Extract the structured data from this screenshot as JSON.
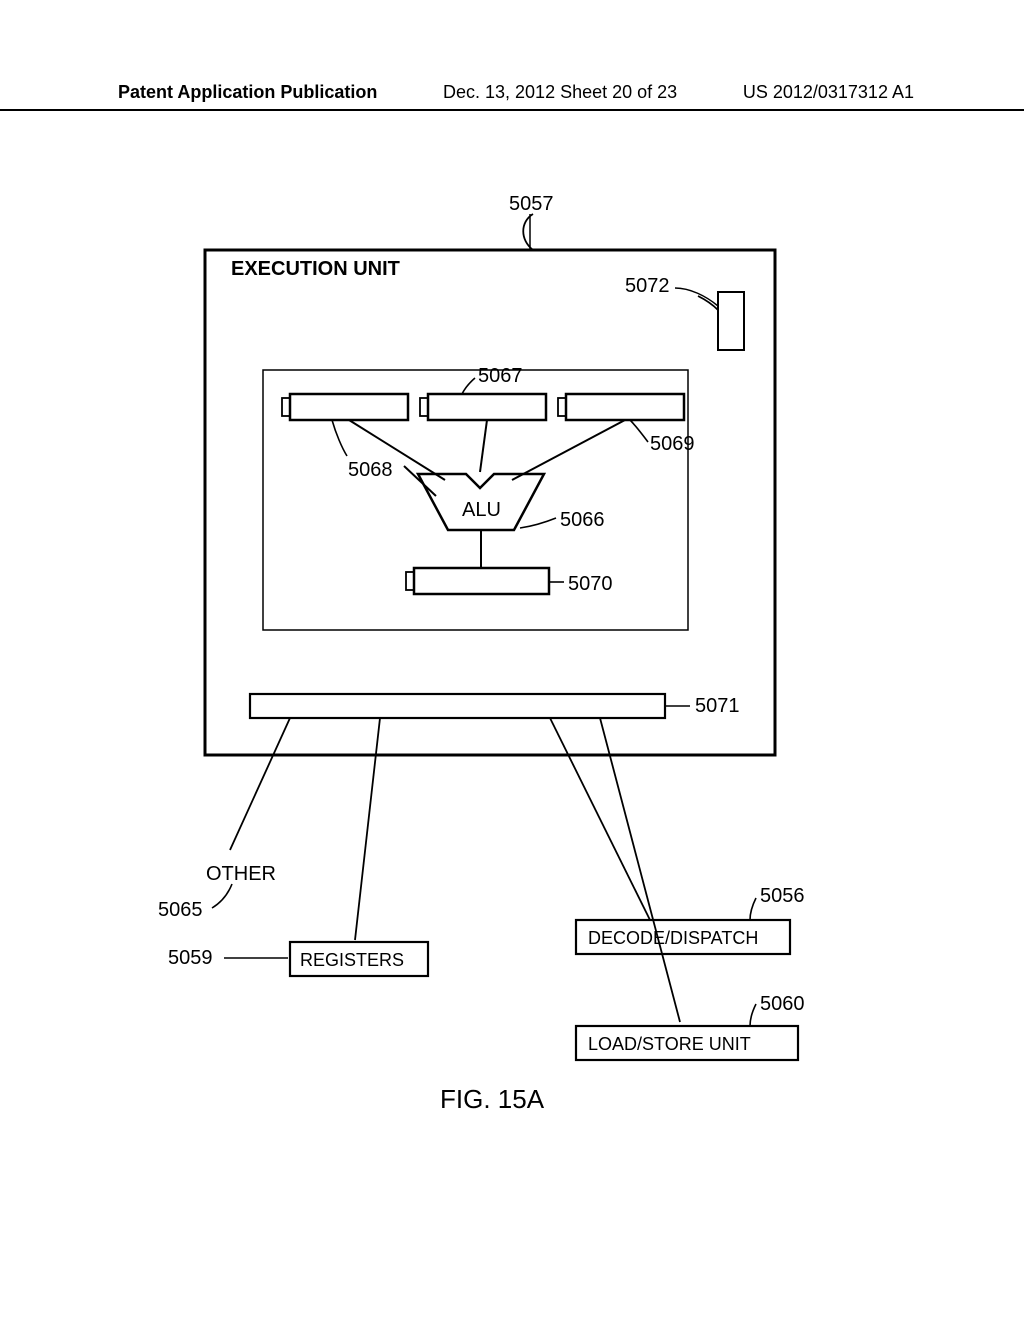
{
  "header": {
    "left": "Patent Application Publication",
    "center": "Dec. 13, 2012  Sheet 20 of 23",
    "right": "US 2012/0317312 A1"
  },
  "labels": {
    "exec_unit": "EXECUTION UNIT",
    "alu": "ALU",
    "other": "OTHER",
    "registers": "REGISTERS",
    "decode_dispatch": "DECODE/DISPATCH",
    "load_store": "LOAD/STORE UNIT",
    "fig": "FIG. 15A"
  },
  "refs": {
    "r5057": "5057",
    "r5072": "5072",
    "r5067": "5067",
    "r5068": "5068",
    "r5069": "5069",
    "r5066": "5066",
    "r5070": "5070",
    "r5071": "5071",
    "r5065": "5065",
    "r5056": "5056",
    "r5059": "5059",
    "r5060": "5060"
  }
}
